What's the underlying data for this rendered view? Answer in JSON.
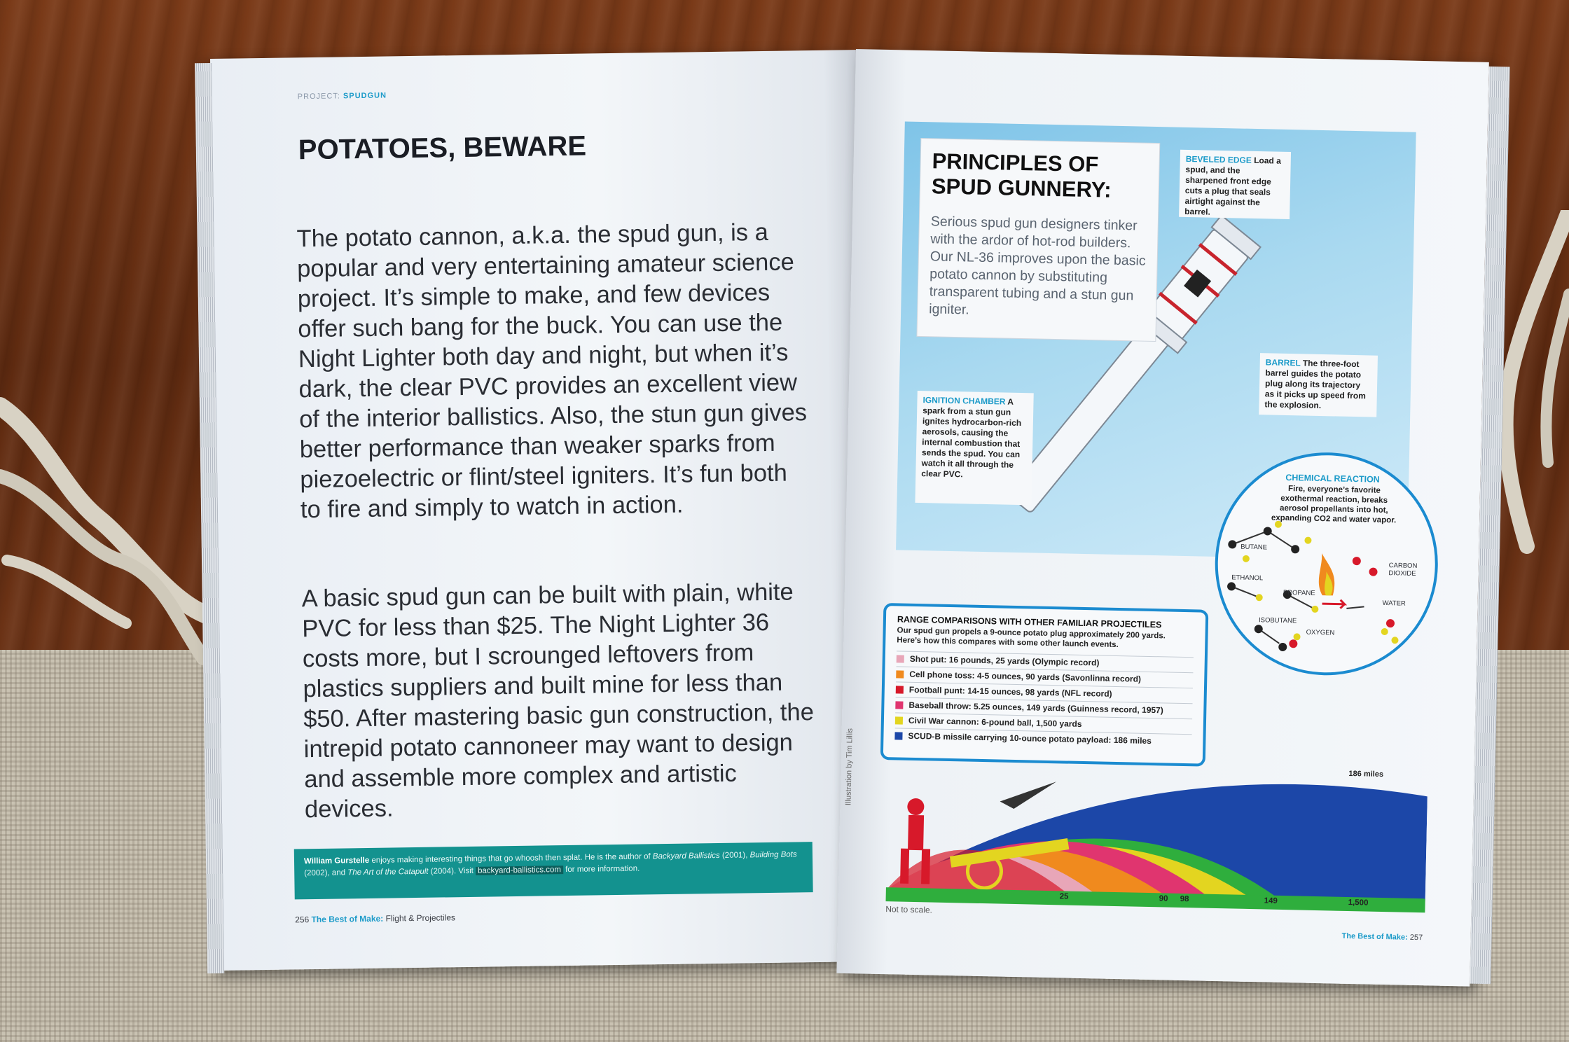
{
  "left_page": {
    "running_head_prefix": "PROJECT:",
    "running_head_topic": "SPUDGUN",
    "headline": "POTATOES, BEWARE",
    "paragraph_1": "The potato cannon, a.k.a. the spud gun, is a popular and very entertaining amateur science project. It’s simple to make, and few devices offer such bang for the buck. You can use the Night Lighter both day and night, but when it’s dark, the clear PVC provides an excellent view of the interior ballistics. Also, the stun gun gives better performance than weaker sparks from piezoelectric or flint/steel igniters. It’s fun both to fire and simply to watch in action.",
    "paragraph_2": "A basic spud gun can be built with plain, white PVC for less than $25. The Night Lighter 36 costs more, but I scrounged leftovers from plastics suppliers and built mine for less than $50. After mastering basic gun construction, the intrepid potato cannoneer may want to design and assemble more complex and artistic devices.",
    "author_name": "William Gurstelle",
    "author_bio_1": "enjoys making interesting things that go whoosh then splat. He is the author of",
    "author_book_1": "Backyard Ballistics",
    "author_bio_2": "(2001),",
    "author_book_2": "Building Bots",
    "author_bio_3": "(2002), and",
    "author_book_3": "The Art of the Catapult",
    "author_bio_4": "(2004). Visit",
    "author_link": "backyard-ballistics.com",
    "author_bio_5": "for more information.",
    "folio_number": "256",
    "folio_book": "The Best of Make:",
    "folio_section": "Flight & Projectiles"
  },
  "right_page": {
    "principles_title": "PRINCIPLES OF SPUD GUNNERY:",
    "principles_text": "Serious spud gun designers tinker with the ardor of hot-rod builders. Our NL-36 improves upon the basic potato cannon by substituting transparent tubing and a stun gun igniter.",
    "callout_bevel_key": "BEVELED EDGE",
    "callout_bevel_text": "Load a spud, and the sharpened front edge cuts a plug that seals airtight against the barrel.",
    "callout_barrel_key": "BARREL",
    "callout_barrel_text": "The three-foot barrel guides the potato plug along its trajectory as it picks up speed from the explosion.",
    "callout_ign_key": "IGNITION CHAMBER",
    "callout_ign_text": "A spark from a stun gun ignites hydrocarbon-rich aerosols, causing the internal combustion that sends the spud. You can watch it all through the clear PVC.",
    "chem_title": "CHEMICAL REACTION",
    "chem_text": "Fire, everyone’s favorite exothermal reaction, breaks aerosol propellants into hot, expanding CO2 and water vapor.",
    "molecules": [
      "BUTANE",
      "ETHANOL",
      "PROPANE",
      "ISOBUTANE",
      "OXYGEN",
      "CARBON DIOXIDE",
      "WATER"
    ],
    "range_title": "RANGE COMPARISONS WITH OTHER FAMILIAR PROJECTILES",
    "range_intro": "Our spud gun propels a 9-ounce potato plug approximately 200 yards. Here’s how this compares with some other launch events.",
    "range_items": [
      {
        "text": "Shot put: 16 pounds, 25 yards (Olympic record)",
        "color": "#e8a6b8"
      },
      {
        "text": "Cell phone toss: 4-5 ounces, 90 yards (Savonlinna record)",
        "color": "#f08a1e"
      },
      {
        "text": "Football punt: 14-15 ounces, 98 yards (NFL record)",
        "color": "#d7192a"
      },
      {
        "text": "Baseball throw: 5.25 ounces, 149 yards (Guinness record, 1957)",
        "color": "#e0356f"
      },
      {
        "text": "Civil War cannon: 6-pound ball, 1,500 yards",
        "color": "#e3d520"
      },
      {
        "text": "SCUD-B missile carrying 10-ounce potato payload: 186 miles",
        "color": "#1c47a8"
      }
    ],
    "range_max_label": "186 miles",
    "ticks": [
      "25",
      "90",
      "98",
      "149",
      "1,500"
    ],
    "not_to_scale": "Not to scale.",
    "credit": "Illustration by Tim Lillis",
    "folio_book": "The Best of Make:",
    "folio_number": "257"
  }
}
